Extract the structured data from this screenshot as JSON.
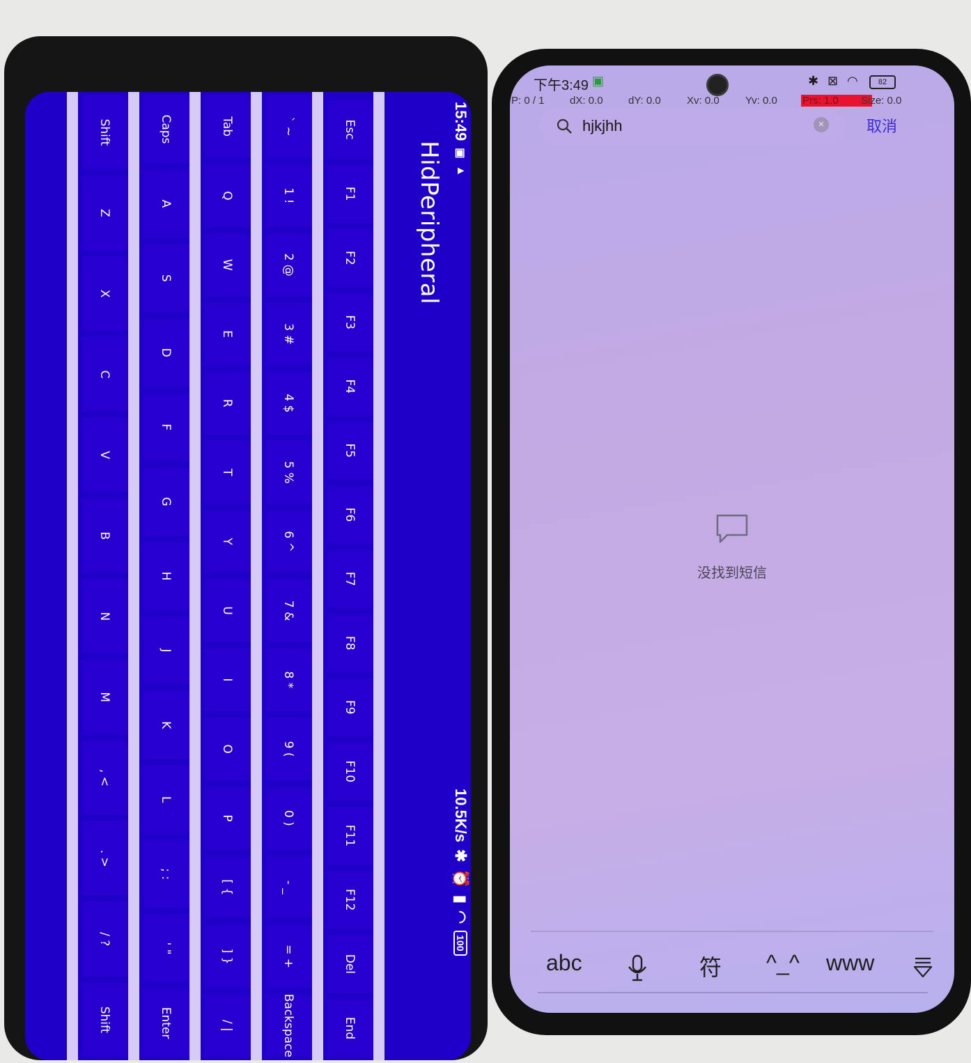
{
  "left_phone": {
    "app_title": "HidPeripheral",
    "status": {
      "time": "15:49",
      "net_speed": "10.5K/s",
      "battery": "100"
    },
    "keyboard_rows": [
      [
        "Esc",
        "F1",
        "F2",
        "F3",
        "F4",
        "F5",
        "F6",
        "F7",
        "F8",
        "F9",
        "F10",
        "F11",
        "F12",
        "Del",
        "End"
      ],
      [
        "` ~",
        "1 !",
        "2 @",
        "3 #",
        "4 $",
        "5 %",
        "6 ^",
        "7 &",
        "8 *",
        "9 (",
        "0 )",
        "- _",
        "= +",
        "Backspace"
      ],
      [
        "Tab",
        "Q",
        "W",
        "E",
        "R",
        "T",
        "Y",
        "U",
        "I",
        "O",
        "P",
        "[ {",
        "] }",
        "/ |"
      ],
      [
        "Caps",
        "A",
        "S",
        "D",
        "F",
        "G",
        "H",
        "J",
        "K",
        "L",
        "; :",
        "' \"",
        "Enter"
      ],
      [
        "Shift",
        "Z",
        "X",
        "C",
        "V",
        "B",
        "N",
        "M",
        ", <",
        ". >",
        "/ ?",
        "Shift"
      ]
    ]
  },
  "right_phone": {
    "status": {
      "time": "下午3:49",
      "battery": "82"
    },
    "debug": {
      "p": "P: 0 / 1",
      "dx": "dX: 0.0",
      "dy": "dY: 0.0",
      "xv": "Xv: 0.0",
      "yv": "Yv: 0.0",
      "prs": "Prs: 1.0",
      "size": "Size: 0.0"
    },
    "search": {
      "value": "hjkjhh"
    },
    "cancel_label": "取消",
    "empty_message": "没找到短信",
    "ime_bar": {
      "abc": "abc",
      "symbols": "符",
      "emoticon": "^_^",
      "www": "www"
    }
  }
}
